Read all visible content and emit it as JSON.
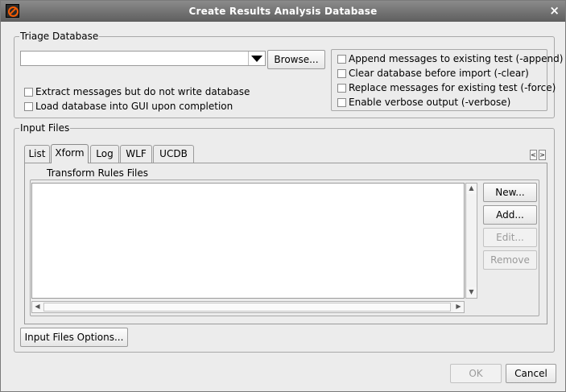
{
  "window": {
    "title": "Create Results Analysis Database",
    "close_icon": "×"
  },
  "triage": {
    "legend": "Triage Database",
    "combo_value": "",
    "browse_label": "Browse...",
    "extract_label": "Extract messages but do not write database",
    "load_gui_label": "Load database into GUI upon completion",
    "options": [
      "Append messages to existing test (-append)",
      "Clear database before import (-clear)",
      "Replace messages for existing test (-force)",
      "Enable verbose output (-verbose)"
    ]
  },
  "input_files": {
    "legend": "Input Files",
    "tabs": [
      "List",
      "Xform",
      "Log",
      "WLF",
      "UCDB"
    ],
    "active_tab": "Xform",
    "tab_scroll_left": "<",
    "tab_scroll_right": ">",
    "transform_legend": "Transform Rules Files",
    "buttons": {
      "new": "New...",
      "add": "Add...",
      "edit": "Edit...",
      "remove": "Remove"
    },
    "options_button": "Input Files Options..."
  },
  "footer": {
    "ok": "OK",
    "cancel": "Cancel"
  }
}
